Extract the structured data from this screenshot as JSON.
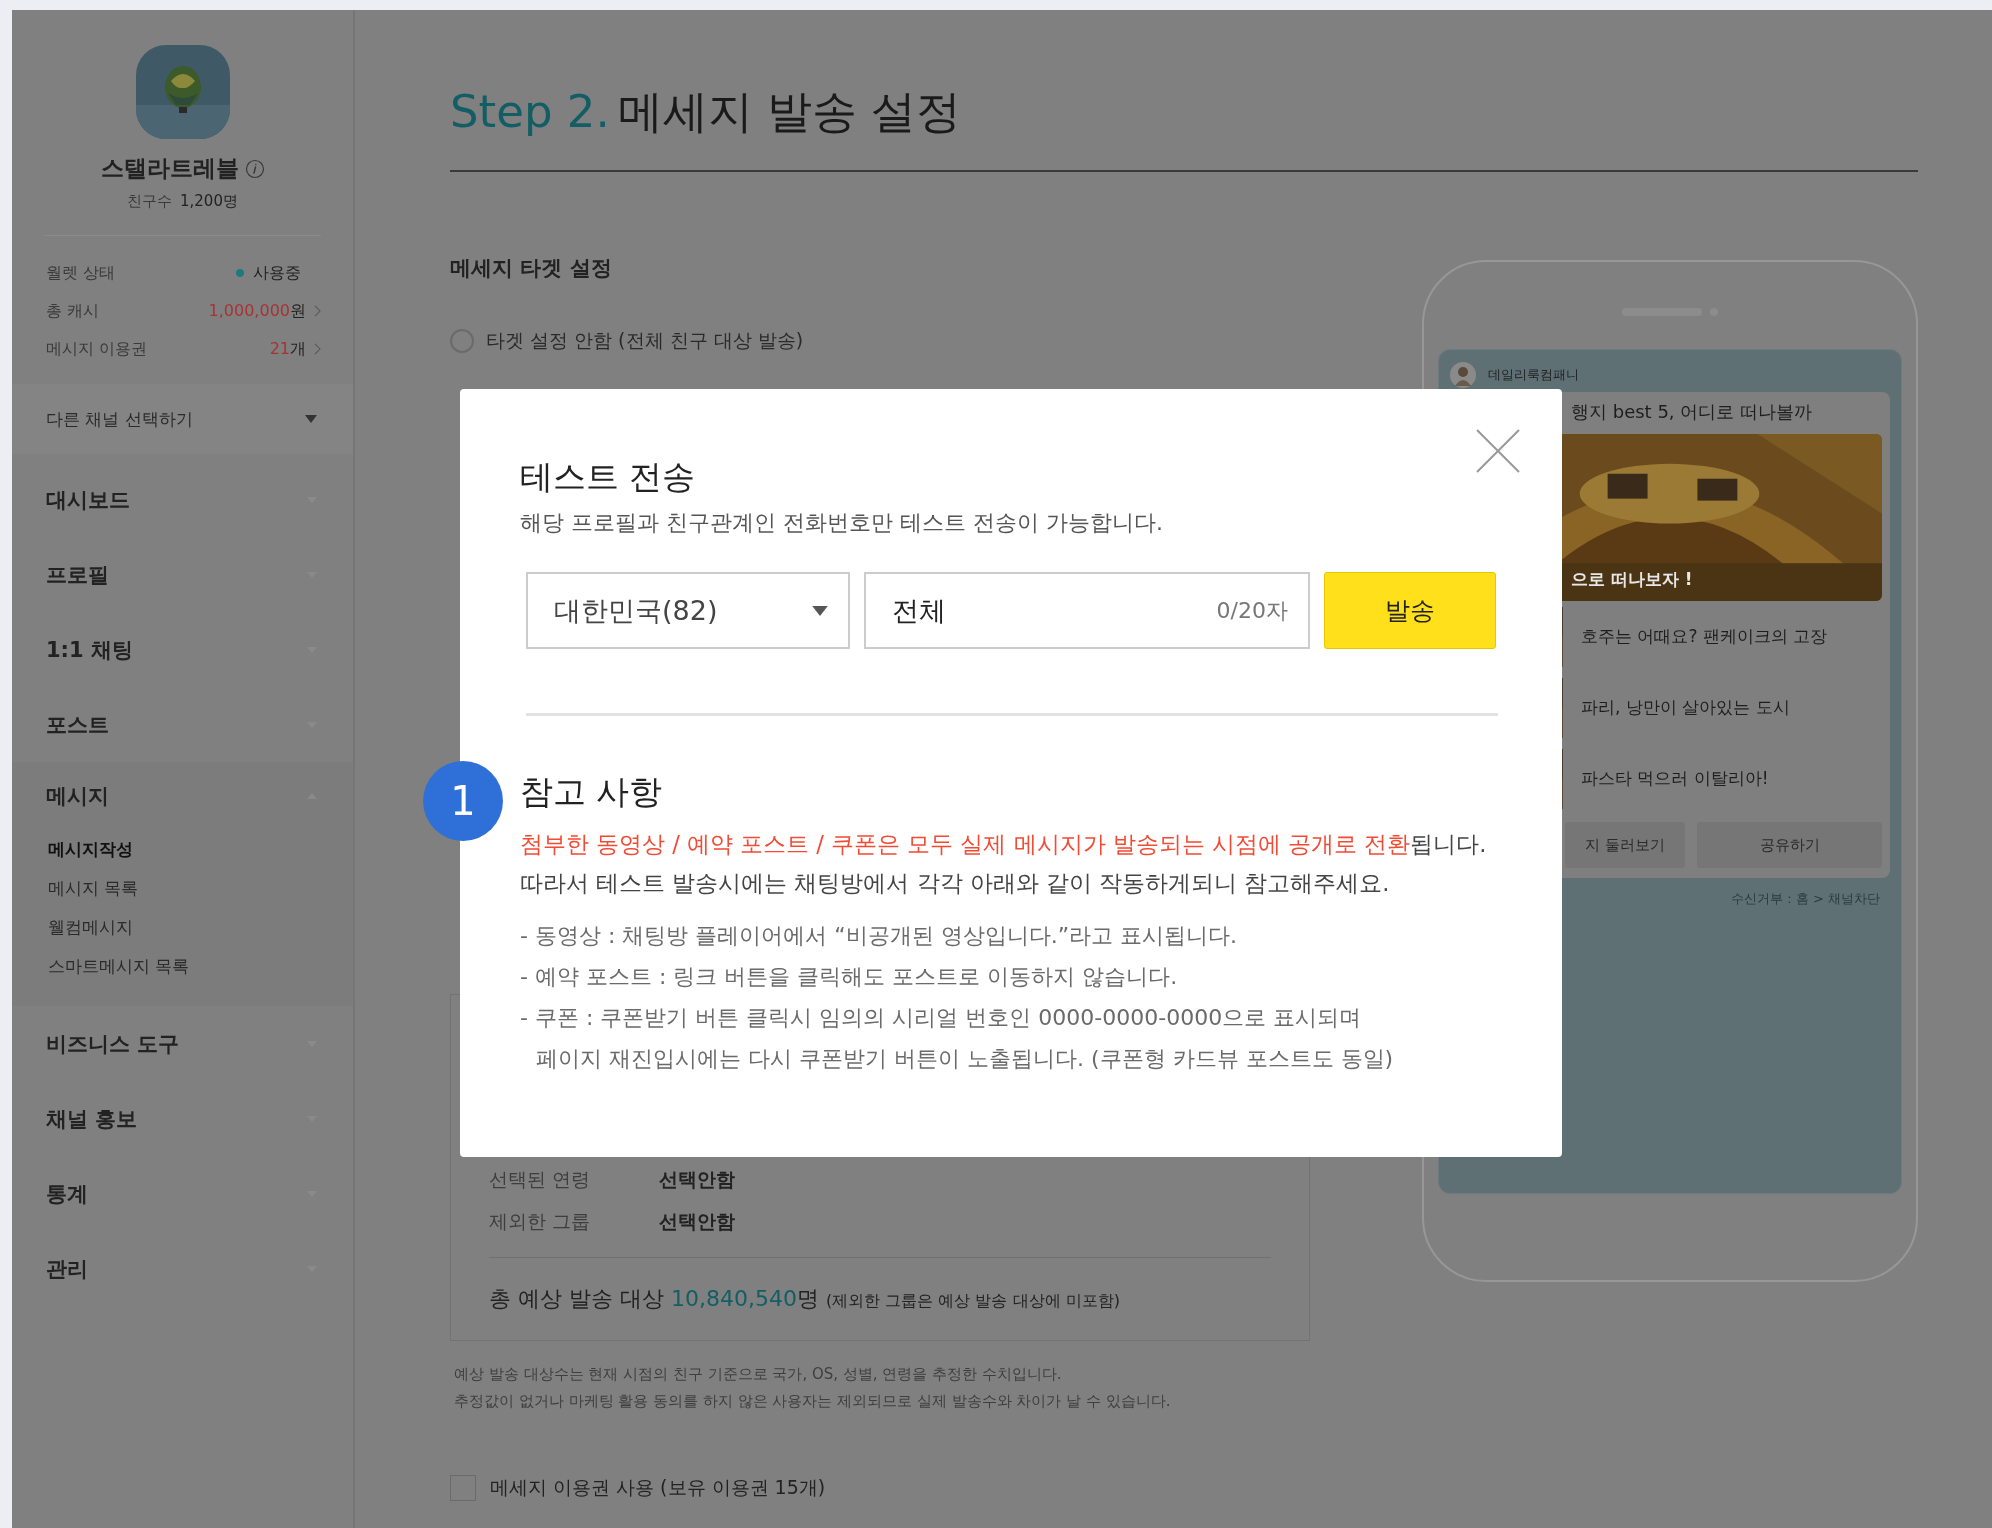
{
  "sidebar": {
    "channel": {
      "name": "스탤라트레블",
      "friends_label": "친구수",
      "friends_count": "1,200명"
    },
    "stats": [
      {
        "kind": "status",
        "label": "월렛 상태",
        "value": "사용중"
      },
      {
        "kind": "amount",
        "label": "총 캐시",
        "value": "1,000,000",
        "unit": "원"
      },
      {
        "kind": "amount",
        "label": "메시지 이용권",
        "value": "21",
        "unit": "개"
      }
    ],
    "channel_select": "다른 채널 선택하기",
    "menu": [
      {
        "label": "대시보드",
        "expanded": false
      },
      {
        "label": "프로필",
        "expanded": false
      },
      {
        "label": "1:1 채팅",
        "expanded": false
      },
      {
        "label": "포스트",
        "expanded": false
      },
      {
        "label": "메시지",
        "expanded": true,
        "children": [
          {
            "label": "메시지작성",
            "selected": true
          },
          {
            "label": "메시지 목록",
            "selected": false
          },
          {
            "label": "웰컴메시지",
            "selected": false
          },
          {
            "label": "스마트메시지 목록",
            "selected": false
          }
        ]
      },
      {
        "label": "비즈니스 도구",
        "expanded": false
      },
      {
        "label": "채널 홍보",
        "expanded": false
      },
      {
        "label": "통계",
        "expanded": false
      },
      {
        "label": "관리",
        "expanded": false
      }
    ]
  },
  "main": {
    "step": "Step 2.",
    "title": "메세지 발송 설정",
    "target": {
      "title": "메세지 타겟 설정",
      "options": [
        {
          "label": "타겟 설정 안함 (전체 친구 대상 발송)",
          "selected": false
        }
      ]
    },
    "summary": {
      "rows": [
        {
          "label": "선택된 연령",
          "value": "선택안함"
        },
        {
          "label": "제외한 그룹",
          "value": "선택안함"
        }
      ],
      "total": {
        "prefix": "총 예상 발송 대상",
        "count": "10,840,540",
        "suffix": "명",
        "note": "(제외한 그룹은 예상 발송 대상에 미포함)"
      }
    },
    "notes": [
      "예상 발송 대상수는 현재 시점의 친구 기준으로 국가, OS, 성별, 연령을 추정한 수치입니다.",
      "추정값이 없거나 마케팅 활용 동의를 하지 않은 사용자는 제외되므로 실제 발송수와 차이가 날 수 있습니다."
    ],
    "ticket": {
      "label": "메세지 이용권 사용 (보유 이용권 15개)",
      "checked": false
    }
  },
  "preview": {
    "sender": "데일리룩컴패니",
    "title": "행지 best 5, 어디로 떠나볼까",
    "caption": "으로 떠나보자 !",
    "items": [
      "호주는 어때요? 팬케이크의 고장",
      "파리, 낭만이 살아있는 도시",
      "파스타 먹으러 이탈리아!"
    ],
    "buttons": [
      "지 둘러보기",
      "공유하기"
    ],
    "footer": "수신거부 : 홈 > 채널차단"
  },
  "dialog": {
    "title": "테스트 전송",
    "subtitle": "해당 프로필과 친구관계인 전화번호만 테스트 전송이 가능합니다.",
    "country": "대한민국(82)",
    "phone": "전체",
    "counter": "0/20자",
    "send": "발송",
    "badge": "1",
    "notice_title": "참고 사항",
    "highlight": "첨부한 동영상 / 예약 포스트 / 쿠폰은 모두 실제 메시지가 발송되는 시점에 공개로 전환",
    "highlight_end": "됩니다.",
    "lead": "따라서 테스트 발송시에는 채팅방에서 각각 아래와 같이 작동하게되니 참고해주세요.",
    "bullets": [
      "- 동영상 : 채팅방 플레이어에서 “비공개된 영상입니다.”라고 표시됩니다.",
      "- 예약 포스트 : 링크 버튼을 클릭해도 포스트로 이동하지 않습니다.",
      "- 쿠폰 : 쿠폰받기 버튼 클릭시 임의의 시리얼 번호인 0000-0000-0000으로 표시되며",
      "페이지 재진입시에는 다시 쿠폰받기 버튼이 노출됩니다. (쿠폰형 카드뷰 포스트도 동일)"
    ]
  }
}
